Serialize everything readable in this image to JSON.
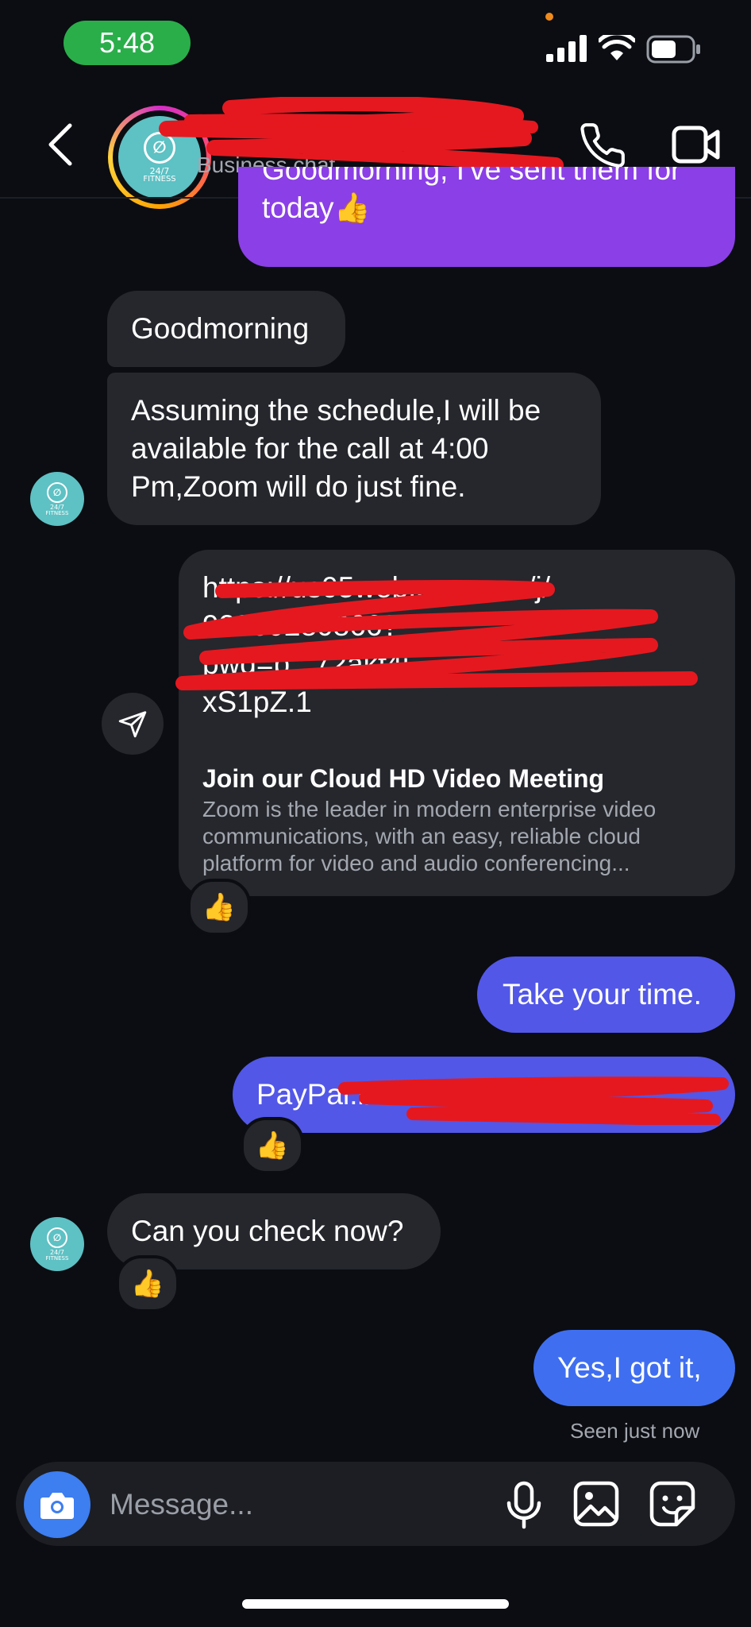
{
  "status_bar": {
    "time": "5:48"
  },
  "header": {
    "title": "",
    "subtitle": "Business chat",
    "avatar_text": {
      "top": "24/7",
      "bottom": "FITNESS"
    }
  },
  "messages": {
    "partial_out_line1": "Goodmorning, I've sent them for",
    "partial_out_line2": "today👍",
    "goodmorning": "Goodmorning",
    "assuming_line1": "Assuming the schedule,I will be",
    "assuming_line2": "available for the call at 4:00",
    "assuming_line3": "Pm,Zoom will do just fine.",
    "link_line1": "https://us05web.zoom.us/j/",
    "link_line2": "92380280866?",
    "link_line3": "pwd=b...72akf4j",
    "link_line4": "xS1pZ.1",
    "link_title": "Join our Cloud HD Video Meeting",
    "link_desc_line1": "Zoom is the leader in modern enterprise video",
    "link_desc_line2": "communications, with an easy, reliable cloud",
    "link_desc_line3": "platform for video and audio conferencing...",
    "take_your_time": "Take your time.",
    "paypal": "PayPal:b...7534756",
    "can_you_check": "Can you check now?",
    "yes_got_it": "Yes,I got it,",
    "seen": "Seen just now"
  },
  "reactions": {
    "thumbs": "👍"
  },
  "composer": {
    "placeholder": "Message..."
  },
  "colors": {
    "background": "#0b0d12",
    "incoming": "#25272d",
    "outgoing_purple": "#8b3fe6",
    "outgoing_blue": "#5257e8",
    "outgoing_blue2": "#3f6ff0",
    "camera": "#3d7ef0",
    "redaction": "#e5181f"
  }
}
